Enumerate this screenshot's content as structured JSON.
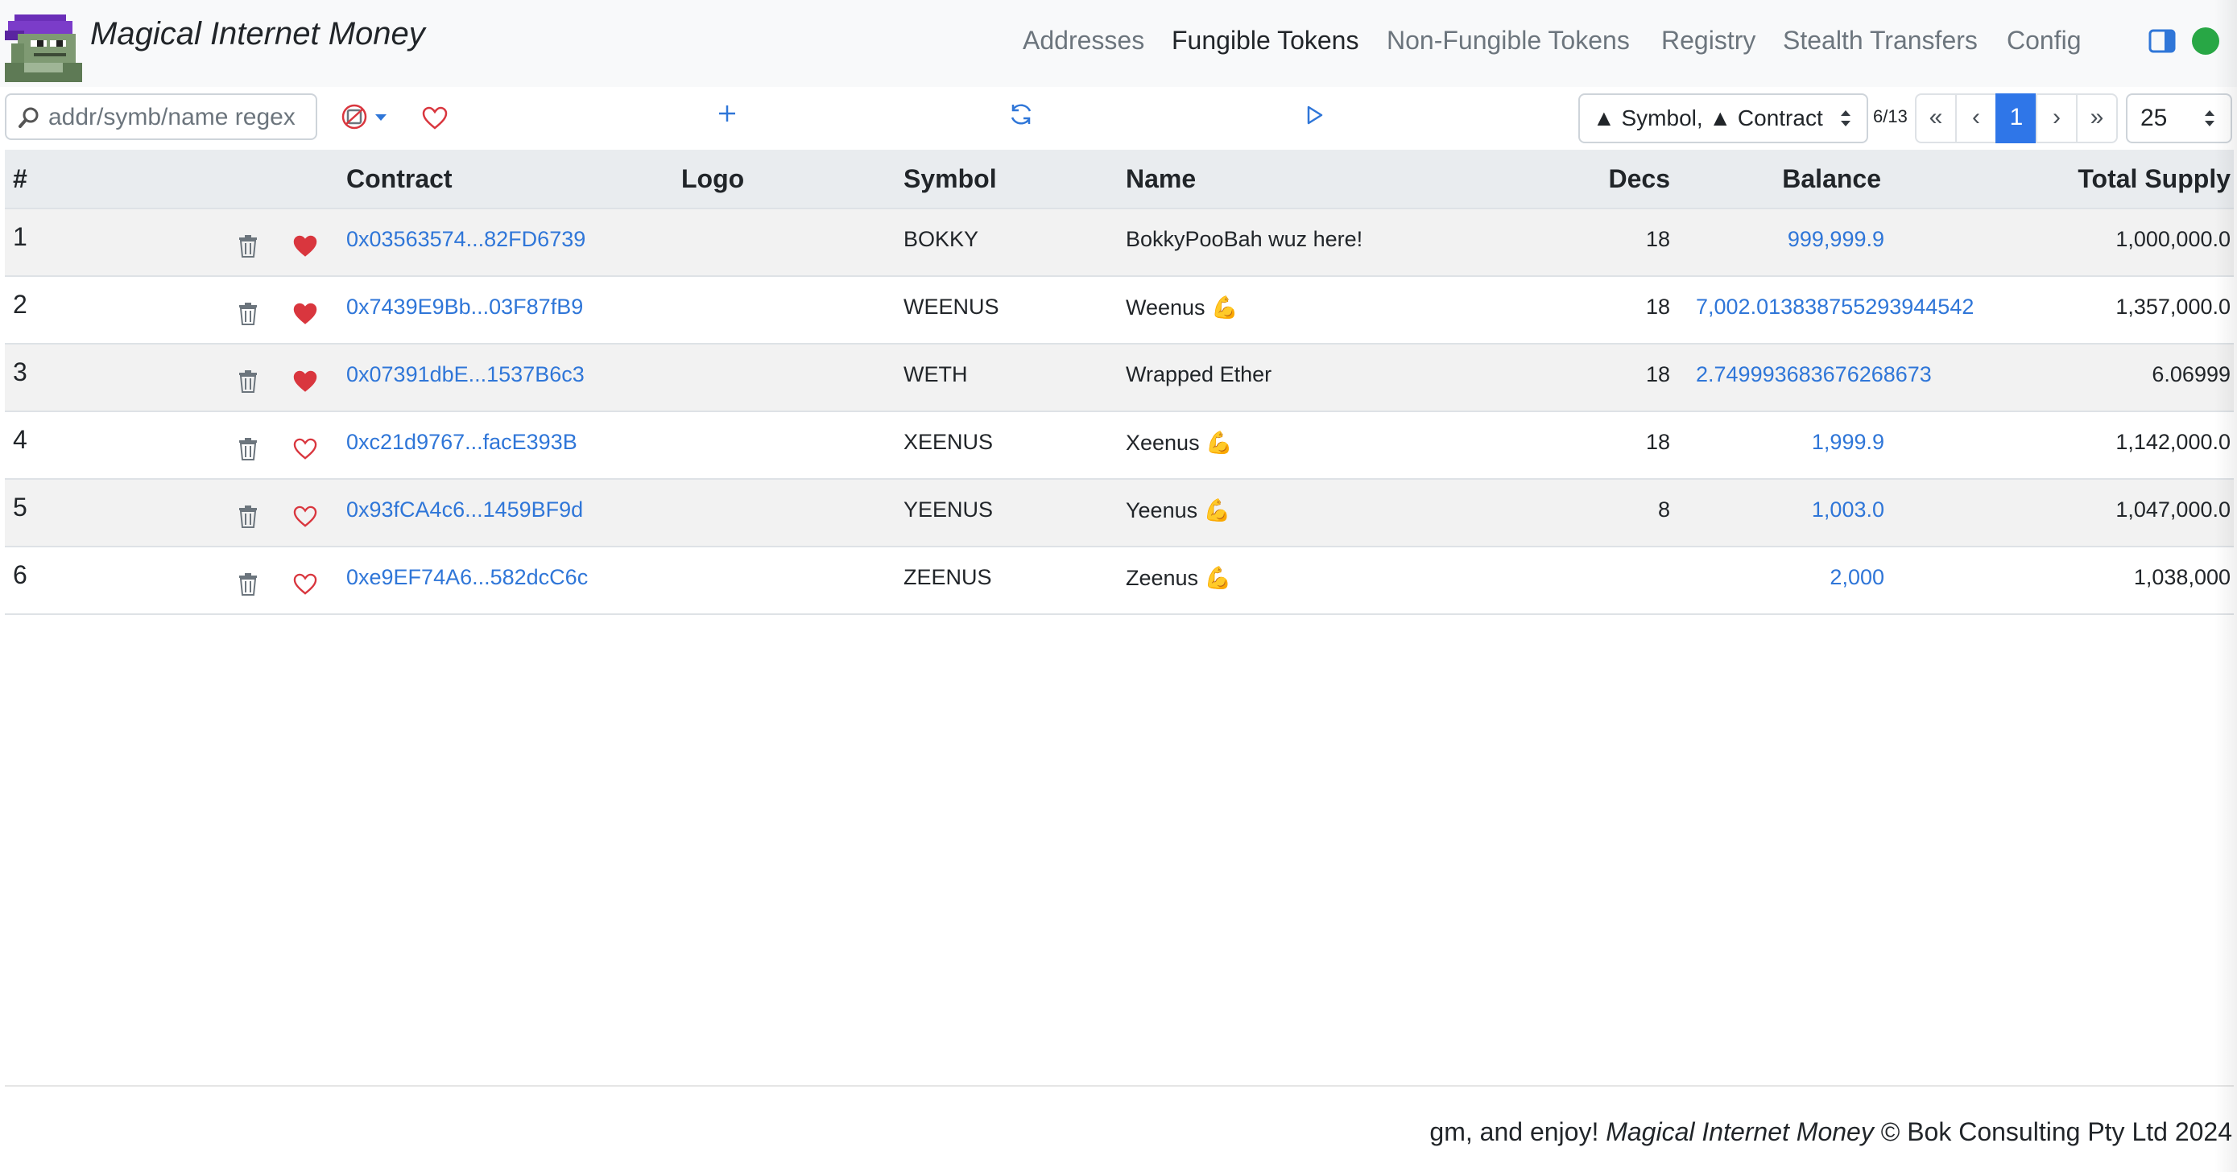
{
  "header": {
    "brand": "Magical Internet Money",
    "nav": [
      {
        "label": "Addresses",
        "active": false
      },
      {
        "label": "Fungible Tokens",
        "active": true
      },
      {
        "label": "Non-Fungible Tokens",
        "active": false
      },
      {
        "label": "Registry",
        "active": false
      },
      {
        "label": "Stealth Transfers",
        "active": false
      },
      {
        "label": "Config",
        "active": false
      }
    ],
    "status_color": "#28a745"
  },
  "toolbar": {
    "search_placeholder": "addr/symb/name regex",
    "filter_icon": "no-photo-filter-icon",
    "favourite_icon": "heart-outline-icon",
    "add_icon": "plus-icon",
    "sync_icon": "sync-icon",
    "play_icon": "play-icon",
    "sort_value": "▲ Symbol, ▲ Contract",
    "page_count": "6/13",
    "pager": [
      "«",
      "‹",
      "1",
      "›",
      "»"
    ],
    "current_page": "1",
    "page_size": "25"
  },
  "table": {
    "headers": {
      "index": "#",
      "contract": "Contract",
      "logo": "Logo",
      "symbol": "Symbol",
      "name": "Name",
      "decimals": "Decs",
      "balance": "Balance",
      "total_supply": "Total Supply"
    },
    "rows": [
      {
        "index": "1",
        "favourite": true,
        "contract": "0x03563574...82FD6739",
        "symbol": "BOKKY",
        "name": "BokkyPooBah wuz here!",
        "decimals": "18",
        "balance": "999,999.9",
        "total_supply": "1,000,000.0"
      },
      {
        "index": "2",
        "favourite": true,
        "contract": "0x7439E9Bb...03F87fB9",
        "symbol": "WEENUS",
        "name": "Weenus 💪",
        "decimals": "18",
        "balance": "7,002.013838755293944542",
        "total_supply": "1,357,000.0"
      },
      {
        "index": "3",
        "favourite": true,
        "contract": "0x07391dbE...1537B6c3",
        "symbol": "WETH",
        "name": "Wrapped Ether",
        "decimals": "18",
        "balance": "2.749993683676268673",
        "total_supply": "6.06999"
      },
      {
        "index": "4",
        "favourite": false,
        "contract": "0xc21d9767...facE393B",
        "symbol": "XEENUS",
        "name": "Xeenus 💪",
        "decimals": "18",
        "balance": "1,999.9",
        "total_supply": "1,142,000.0"
      },
      {
        "index": "5",
        "favourite": false,
        "contract": "0x93fCA4c6...1459BF9d",
        "symbol": "YEENUS",
        "name": "Yeenus 💪",
        "decimals": "8",
        "balance": "1,003.0",
        "total_supply": "1,047,000.0"
      },
      {
        "index": "6",
        "favourite": false,
        "contract": "0xe9EF74A6...582dcC6c",
        "symbol": "ZEENUS",
        "name": "Zeenus 💪",
        "decimals": "",
        "balance": "2,000",
        "total_supply": "1,038,000"
      }
    ]
  },
  "footer": {
    "prefix": "gm, and enjoy! ",
    "brand": "Magical Internet Money",
    "suffix": " © Bok Consulting Pty Ltd 2024"
  },
  "colors": {
    "link": "#2f76d8",
    "heart": "#d9363e",
    "active_page": "#2f76e8"
  }
}
